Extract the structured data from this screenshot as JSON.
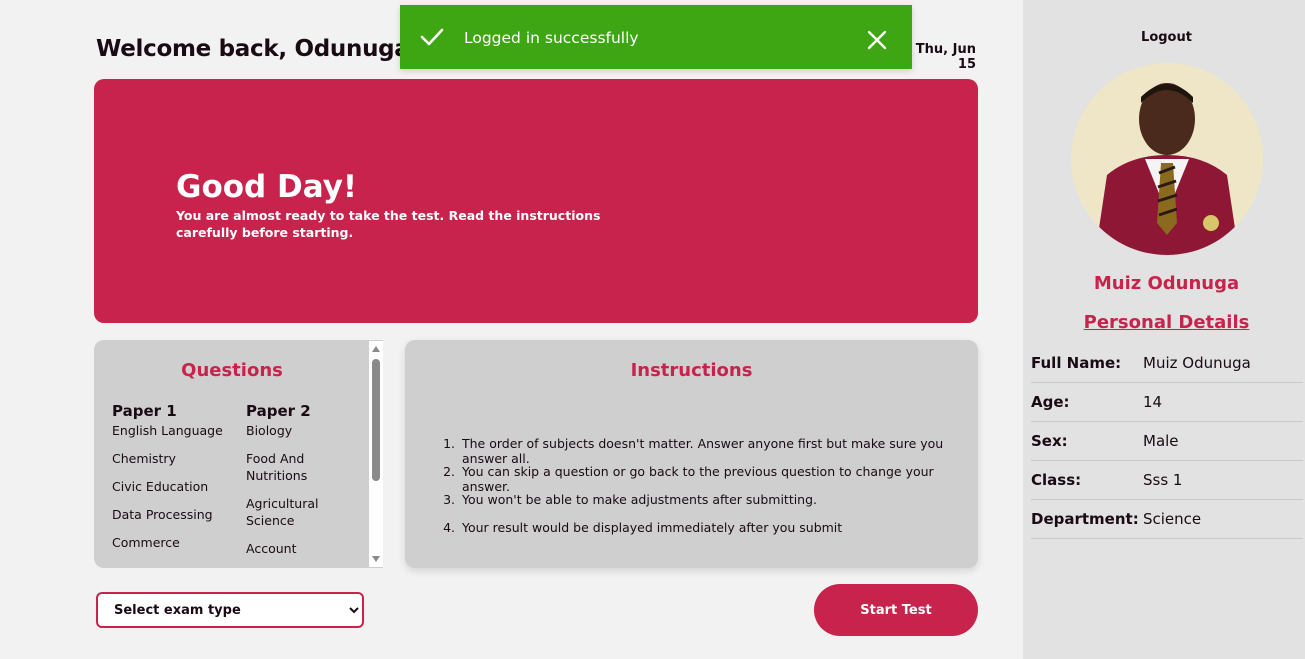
{
  "header": {
    "welcome": "Welcome back, Odunuga",
    "date": "Thu, Jun 15"
  },
  "toast": {
    "message": "Logged in successfully",
    "status_color": "#3ea613"
  },
  "hero": {
    "title": "Good Day!",
    "subtitle": "You are almost ready to take the test. Read the instructions carefully before starting.",
    "color": "#c7234c"
  },
  "questions": {
    "heading": "Questions",
    "papers": [
      {
        "title": "Paper 1",
        "subjects": [
          "English Language",
          "Chemistry",
          "Civic Education",
          "Data Processing",
          "Commerce"
        ]
      },
      {
        "title": "Paper 2",
        "subjects": [
          "Biology",
          "Food And Nutritions",
          "Agricultural Science",
          "Account"
        ]
      }
    ]
  },
  "instructions": {
    "heading": "Instructions",
    "items": [
      "The order of subjects doesn't matter. Answer anyone first but make sure you answer all.",
      "You can skip a question or go back to the previous question to change your answer.",
      "You won't be able to make adjustments after submitting.",
      "Your result would be displayed immediately after you submit"
    ]
  },
  "controls": {
    "select_label": "Select exam type",
    "start_label": "Start Test"
  },
  "sidebar": {
    "logout": "Logout",
    "name": "Muiz Odunuga",
    "personal_details": "Personal Details",
    "details": [
      {
        "key": "Full Name:",
        "value": "Muiz Odunuga"
      },
      {
        "key": "Age:",
        "value": "14"
      },
      {
        "key": "Sex:",
        "value": "Male"
      },
      {
        "key": "Class:",
        "value": "Sss 1"
      },
      {
        "key": "Department:",
        "value": "Science"
      }
    ]
  }
}
